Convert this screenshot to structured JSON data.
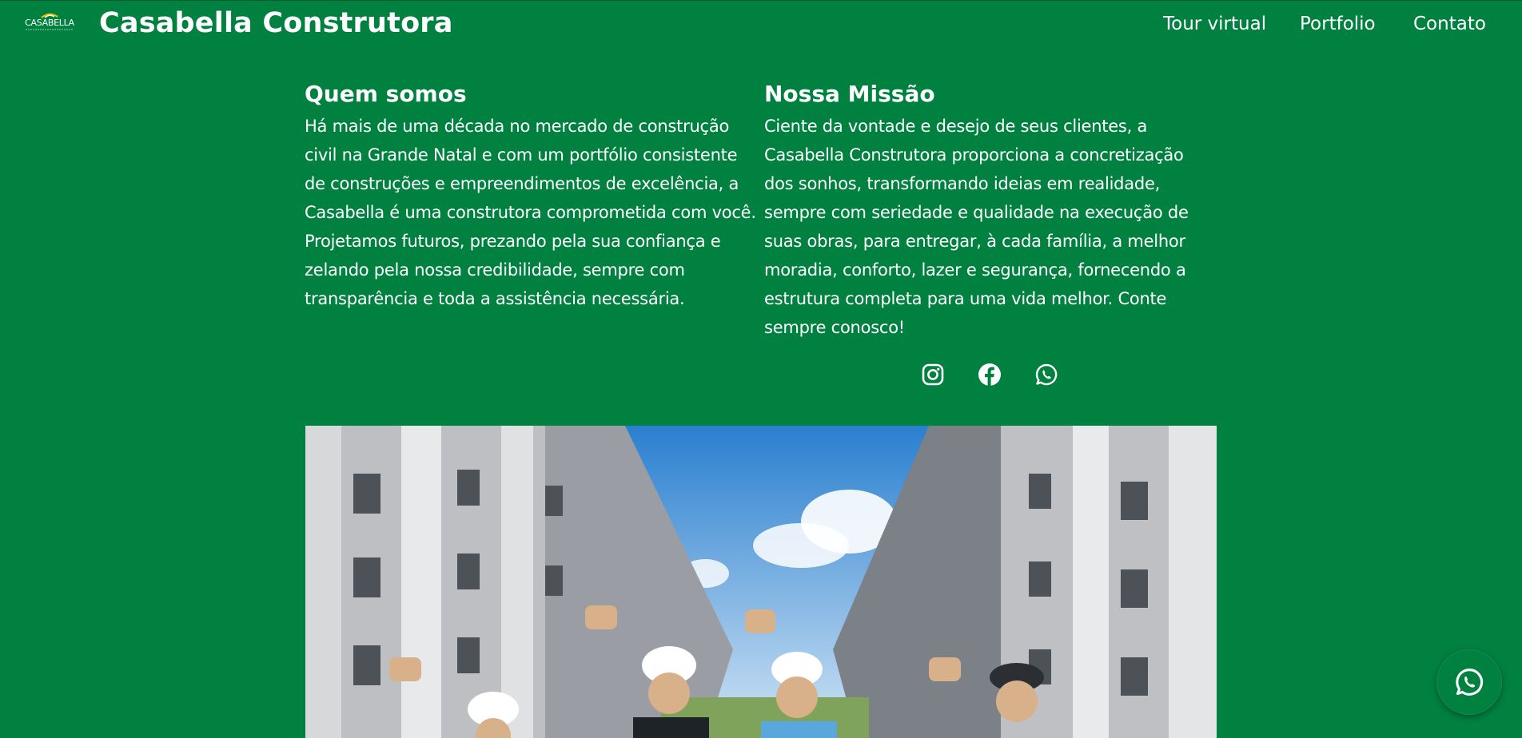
{
  "header": {
    "logo_text": "CASABELLA",
    "brand": "Casabella Construtora",
    "nav": [
      {
        "label": "Tour virtual"
      },
      {
        "label": "Portfolio"
      },
      {
        "label": "Contato"
      }
    ]
  },
  "about": {
    "title": "Quem somos",
    "text": "Há mais de uma década no mercado de construção civil na Grande Natal e com um portfólio consistente de construções e empreendimentos de excelência, a Casabella é uma construtora comprometida com você. Projetamos futuros, prezando pela sua confiança e zelando pela nossa credibilidade, sempre com transparência e toda a assistência necessária."
  },
  "mission": {
    "title": "Nossa Missão",
    "text": "Ciente da vontade e desejo de seus clientes, a Casabella Construtora proporciona a concretização dos sonhos, transformando ideias em realidade, sempre com seriedade e qualidade na execução de suas obras, para entregar, à cada família, a melhor moradia, conforto, lazer e segurança, fornecendo a estrutura completa para uma vida melhor. Conte sempre conosco!"
  },
  "social": [
    {
      "icon": "instagram-icon"
    },
    {
      "icon": "facebook-icon"
    },
    {
      "icon": "whatsapp-icon"
    }
  ],
  "floating_button": {
    "icon": "whatsapp-icon"
  },
  "colors": {
    "background": "#008140",
    "text": "#ffffff"
  }
}
